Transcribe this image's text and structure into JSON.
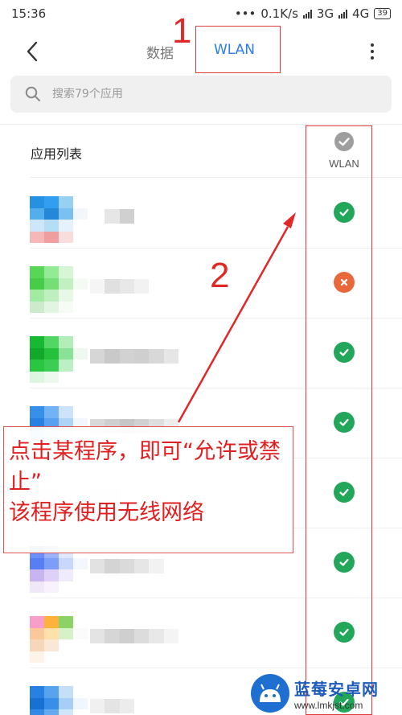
{
  "status_bar": {
    "time": "15:36",
    "dots": "•••",
    "speed": "0.1K/s",
    "network_3g": "3G",
    "network_4g": "4G",
    "battery": "39"
  },
  "header": {
    "tabs": [
      {
        "label": "数据",
        "active": false
      },
      {
        "label": "WLAN",
        "active": true
      }
    ]
  },
  "search": {
    "placeholder": "搜索79个应用"
  },
  "list": {
    "title": "应用列表",
    "column_label": "WLAN",
    "rows": [
      {
        "wlan_allowed": true
      },
      {
        "wlan_allowed": false
      },
      {
        "wlan_allowed": true
      },
      {
        "wlan_allowed": true
      },
      {
        "wlan_allowed": true
      },
      {
        "wlan_allowed": true
      },
      {
        "wlan_allowed": true
      },
      {
        "wlan_allowed": true
      }
    ]
  },
  "annotations": {
    "marker_1": "1",
    "marker_2": "2",
    "note_line1": "点击某程序，即可“允许或禁止”",
    "note_line2": "该程序使用无线网络"
  },
  "watermark": {
    "title": "蓝莓安卓网",
    "url": "www.lmkjst.com"
  },
  "colors": {
    "accent": "#2b7de9",
    "allowed": "#22a65a",
    "denied": "#e9683a",
    "annotation": "#e02828"
  }
}
